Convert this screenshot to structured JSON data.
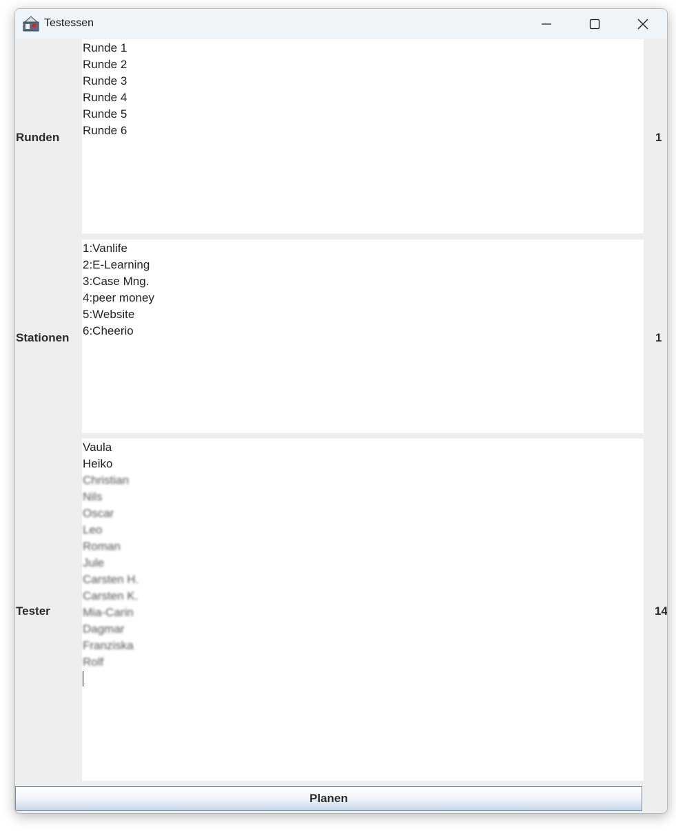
{
  "window": {
    "title": "Testessen"
  },
  "rows": [
    {
      "label": "Runden",
      "count": "1",
      "items": [
        "Runde 1",
        "Runde 2",
        "Runde 3",
        "Runde 4",
        "Runde 5",
        "Runde 6"
      ]
    },
    {
      "label": "Stationen",
      "count": "1",
      "items": [
        "1:Vanlife",
        "2:E-Learning",
        "3:Case Mng.",
        "4:peer money",
        "5:Website",
        "6:Cheerio"
      ]
    },
    {
      "label": "Tester",
      "count": "14",
      "items": [
        "Vaula",
        "Heiko",
        "Christian",
        "Nils",
        "Oscar",
        "Leo",
        "Roman",
        "Jule",
        "Carsten H.",
        "Carsten K.",
        "Mia-Carin",
        "Dagmar",
        "Franziska",
        "Rolf"
      ]
    }
  ],
  "actions": {
    "plan_label": "Planen"
  },
  "colors": {
    "window_bg": "#eeeeee",
    "titlebar_bg": "#eff4f9",
    "textarea_bg": "#ffffff"
  }
}
